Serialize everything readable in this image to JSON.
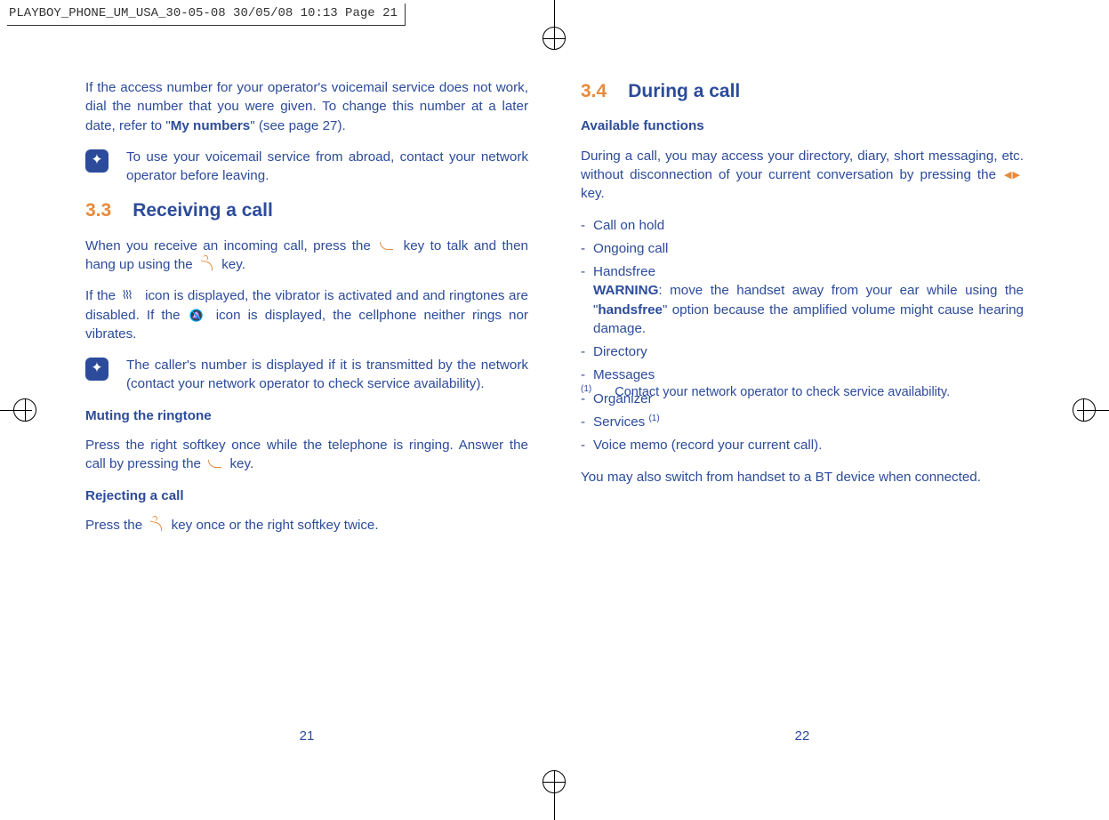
{
  "crop_header": "PLAYBOY_PHONE_UM_USA_30-05-08  30/05/08  10:13  Page 21",
  "left": {
    "intro": "If the access number for your operator's voicemail service does not work, dial the number that you were given.  To change this number at a later date,  refer to \"",
    "intro_bold": "My numbers",
    "intro_tail": "\" (see page 27).",
    "tip1": "To use your voicemail service from abroad,  contact your network operator before leaving.",
    "h_num": "3.3",
    "h_title": "Receiving a call",
    "p1_a": "When you receive an incoming call, press the ",
    "p1_b": " key to talk and then hang up using the ",
    "p1_c": " key.",
    "p2_a": "If the ",
    "p2_b": " icon is displayed,  the vibrator is activated and and ringtones are disabled. If the ",
    "p2_c": " icon is displayed, the cellphone neither rings nor vibrates.",
    "tip2": "The caller's number is displayed if it is transmitted by the network (contact your network operator to check service availability).",
    "sub1": "Muting the ringtone",
    "p3_a": "Press the right softkey once while the telephone is ringing.  Answer the call by pressing the ",
    "p3_b": " key.",
    "sub2": "Rejecting a call",
    "p4_a": "Press the ",
    "p4_b": " key once or the right softkey twice.",
    "pagenum": "21"
  },
  "right": {
    "h_num": "3.4",
    "h_title": "During a call",
    "sub1": "Available functions",
    "p1_a": "During a call,  you may access your directory,  diary,  short messaging,  etc. without disconnection of your current conversation by pressing the ",
    "p1_b": " key.",
    "items": {
      "i1": "Call on hold",
      "i2": "Ongoing call",
      "i3a": "Handsfree",
      "i3_warn": "WARNING",
      "i3b": ": move the handset away from your ear while using the \"",
      "i3_bold": "handsfree",
      "i3c": "\" option because the amplified volume might cause hearing damage.",
      "i4": "Directory",
      "i5": "Messages",
      "i6": "Organizer",
      "i7": "Services ",
      "i7_sup": "(1)",
      "i8": "Voice memo (record your current call)."
    },
    "p2": "You may also switch from handset to a BT device when connected.",
    "fn_mark": "(1)",
    "fn_text": "Contact your network operator to check service availability.",
    "pagenum": "22"
  }
}
